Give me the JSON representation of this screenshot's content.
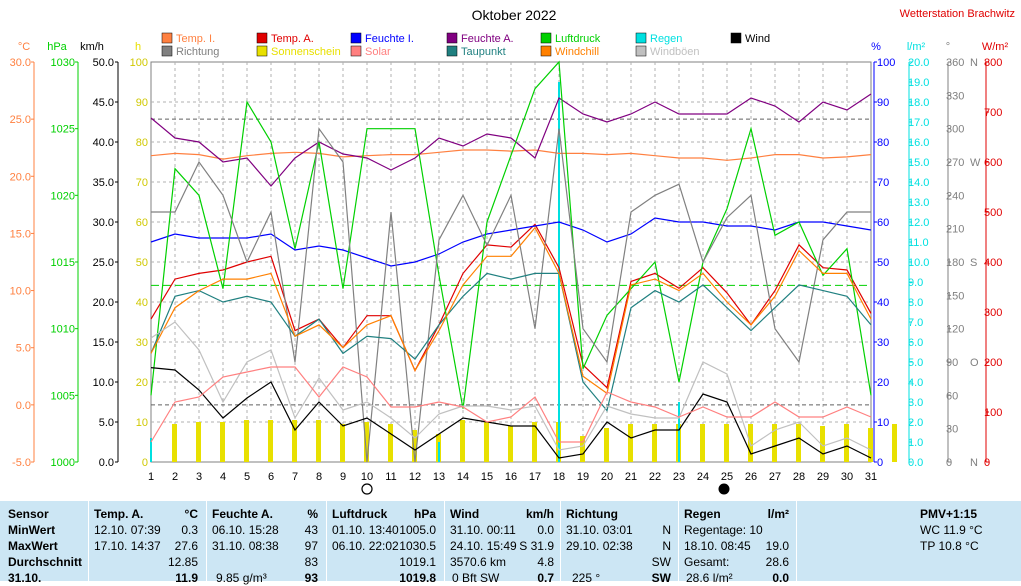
{
  "colors": {
    "temp_in": "#ff8040",
    "temp_out": "#e00000",
    "hum_in": "#0000ff",
    "hum_out": "#800080",
    "pressure": "#00d000",
    "rain": "#00e0e0",
    "wind": "#000000",
    "direction": "#808080",
    "sunshine": "#e8e000",
    "solar": "#ff8080",
    "dewpoint": "#208080",
    "windchill": "#ff8000",
    "gusts": "#c0c0c0",
    "station": "#e00000"
  },
  "chart_data": {
    "type": "line",
    "title": "Oktober 2022",
    "station": "Wetterstation Brachwitz",
    "x": [
      1,
      2,
      3,
      4,
      5,
      6,
      7,
      8,
      9,
      10,
      11,
      12,
      13,
      14,
      15,
      16,
      17,
      18,
      19,
      20,
      21,
      22,
      23,
      24,
      25,
      26,
      27,
      28,
      29,
      30,
      31
    ],
    "xlim": [
      1,
      31
    ],
    "moon_new_day": 25,
    "moon_full_day": 10,
    "legend": [
      {
        "label": "Temp. I.",
        "color": "#ff8040"
      },
      {
        "label": "Temp. A.",
        "color": "#e00000"
      },
      {
        "label": "Feuchte I.",
        "color": "#0000ff"
      },
      {
        "label": "Feuchte A.",
        "color": "#800080"
      },
      {
        "label": "Luftdruck",
        "color": "#00d000"
      },
      {
        "label": "Regen",
        "color": "#00e0e0"
      },
      {
        "label": "Wind",
        "color": "#000000"
      },
      {
        "label": "Richtung",
        "color": "#808080"
      },
      {
        "label": "Sonnenschein",
        "color": "#e8e000"
      },
      {
        "label": "Solar",
        "color": "#ff8080"
      },
      {
        "label": "Taupunkt",
        "color": "#208080"
      },
      {
        "label": "Windchill",
        "color": "#ff8000"
      },
      {
        "label": "Windböen",
        "color": "#c0c0c0"
      }
    ],
    "axes": [
      {
        "unit": "°C",
        "min": -5,
        "max": 30,
        "step": 5,
        "decimals": 1,
        "color": "#ff8040",
        "side": "left"
      },
      {
        "unit": "hPa",
        "min": 1000,
        "max": 1030,
        "step": 5,
        "decimals": 0,
        "color": "#00d000",
        "side": "left"
      },
      {
        "unit": "km/h",
        "min": 0,
        "max": 50,
        "step": 5,
        "decimals": 1,
        "color": "#000000",
        "side": "left"
      },
      {
        "unit": "h",
        "min": 0,
        "max": 100,
        "step": 10,
        "decimals": 0,
        "color": "#e8e000",
        "side": "left"
      },
      {
        "unit": "%",
        "min": 0,
        "max": 100,
        "step": 10,
        "decimals": 0,
        "color": "#0000ff",
        "side": "right"
      },
      {
        "unit": "l/m²",
        "min": 0,
        "max": 20,
        "step": 1,
        "decimals": 1,
        "color": "#00e0e0",
        "side": "right"
      },
      {
        "unit": "°",
        "min": 0,
        "max": 360,
        "step": 30,
        "decimals": 0,
        "color": "#808080",
        "side": "right"
      },
      {
        "unit": "W/m²",
        "min": 0,
        "max": 800,
        "step": 100,
        "decimals": 0,
        "color": "#e00000",
        "side": "right"
      }
    ],
    "compass": [
      {
        "label": "N",
        "value": 0
      },
      {
        "label": "O",
        "value": 90
      },
      {
        "label": "S",
        "value": 180
      },
      {
        "label": "W",
        "value": 270
      },
      {
        "label": "N",
        "value": 360
      }
    ],
    "series": [
      {
        "name": "Temp. I.",
        "axis": 0,
        "color": "#ff8040",
        "values": [
          21.8,
          22.0,
          21.9,
          21.5,
          21.8,
          22.0,
          22.1,
          22.0,
          21.7,
          21.8,
          21.9,
          21.9,
          22.1,
          22.3,
          22.3,
          22.2,
          22.3,
          22.0,
          22.0,
          21.9,
          22.0,
          21.8,
          21.6,
          21.6,
          21.4,
          21.6,
          21.9,
          21.9,
          21.6,
          21.7,
          21.9
        ]
      },
      {
        "name": "Temp. A.",
        "axis": 0,
        "color": "#e00000",
        "values": [
          7.5,
          11.0,
          11.5,
          11.8,
          12.5,
          13.0,
          6.5,
          7.5,
          5.0,
          7.8,
          7.8,
          3.0,
          7.0,
          11.5,
          14.0,
          13.8,
          15.8,
          12.0,
          3.5,
          1.5,
          10.8,
          11.5,
          10.2,
          12.0,
          9.8,
          7.0,
          10.0,
          14.0,
          12.0,
          11.8,
          8.0
        ]
      },
      {
        "name": "Feuchte I.",
        "axis": 4,
        "color": "#0000ff",
        "values": [
          55,
          57,
          56,
          56,
          56,
          57,
          53,
          54,
          53,
          51,
          49,
          50,
          52,
          55,
          57,
          58,
          59,
          60,
          58,
          55,
          57,
          61,
          60,
          60,
          59,
          59,
          58,
          60,
          60,
          59,
          58
        ]
      },
      {
        "name": "Feuchte A.",
        "axis": 4,
        "color": "#800080",
        "values": [
          86,
          81,
          80,
          75,
          76,
          69,
          76,
          80,
          77,
          76,
          73,
          76,
          81,
          79,
          82,
          81,
          76,
          91,
          87,
          85,
          87,
          90,
          87,
          87,
          87,
          91,
          89,
          85,
          90,
          88,
          92
        ]
      },
      {
        "name": "Luftdruck",
        "axis": 1,
        "color": "#00d000",
        "values": [
          1005,
          1022,
          1020,
          1013,
          1027,
          1024,
          1016,
          1024,
          1013,
          1025,
          1025,
          1025,
          1014,
          1004,
          1018,
          1023,
          1028,
          1030,
          1007,
          1011,
          1013,
          1015,
          1006,
          1015,
          1019,
          1025,
          1017,
          1018,
          1014,
          1016,
          1005
        ]
      },
      {
        "name": "Richtung",
        "axis": 6,
        "color": "#808080",
        "values": [
          225,
          225,
          270,
          240,
          180,
          225,
          90,
          300,
          270,
          0,
          225,
          0,
          200,
          240,
          195,
          240,
          120,
          300,
          120,
          90,
          225,
          240,
          250,
          180,
          220,
          240,
          120,
          90,
          200,
          225,
          225
        ]
      },
      {
        "name": "Taupunkt",
        "axis": 0,
        "color": "#208080",
        "values": [
          4.5,
          9.5,
          10.0,
          9.0,
          9.5,
          9.0,
          6.0,
          7.5,
          4.5,
          6.0,
          5.8,
          4.0,
          7.0,
          9.5,
          11.5,
          11.0,
          11.5,
          11.5,
          2.0,
          -0.5,
          8.5,
          10.0,
          9.0,
          10.5,
          8.5,
          6.5,
          8.5,
          10.5,
          10.0,
          9.5,
          7.0
        ]
      },
      {
        "name": "Windchill",
        "axis": 0,
        "color": "#ff8000",
        "values": [
          4.5,
          8.5,
          10.0,
          11.0,
          11.0,
          11.5,
          6.0,
          7.0,
          5.0,
          7.0,
          7.8,
          3.0,
          6.5,
          10.5,
          13.0,
          13.0,
          15.5,
          11.5,
          2.5,
          1.0,
          10.5,
          11.0,
          10.0,
          11.5,
          9.0,
          7.0,
          9.5,
          13.5,
          11.5,
          11.5,
          7.5
        ]
      },
      {
        "name": "Wind",
        "axis": 2,
        "color": "#000000",
        "values": [
          11.8,
          11.5,
          9.0,
          5.5,
          8.0,
          10.0,
          4.0,
          7.5,
          4.5,
          5.5,
          3.5,
          1.5,
          3.5,
          5.5,
          5.0,
          4.5,
          4.5,
          0.5,
          1.0,
          5.0,
          3.0,
          4.0,
          4.0,
          8.5,
          7.5,
          1.0,
          2.0,
          3.0,
          1.0,
          2.0,
          0.5
        ]
      },
      {
        "name": "Windböen",
        "axis": 2,
        "color": "#c0c0c0",
        "values": [
          15.5,
          17.5,
          14.0,
          7.5,
          12.5,
          14.0,
          5.5,
          10.5,
          6.5,
          7.5,
          5.5,
          3.0,
          6.0,
          7.0,
          7.0,
          6.5,
          7.0,
          1.5,
          2.0,
          7.0,
          6.0,
          5.5,
          5.5,
          12.5,
          11.0,
          2.0,
          4.0,
          5.0,
          2.0,
          3.0,
          1.5
        ]
      },
      {
        "name": "Solar",
        "axis": 7,
        "color": "#ff8080",
        "values": [
          40,
          120,
          130,
          170,
          180,
          190,
          190,
          130,
          190,
          170,
          110,
          110,
          120,
          110,
          80,
          90,
          130,
          40,
          40,
          140,
          120,
          110,
          90,
          110,
          90,
          90,
          120,
          90,
          90,
          110,
          90
        ]
      }
    ],
    "sunshine": [
      9.5,
      10.0,
      10.0,
      10.5,
      10.5,
      10.5,
      10.5,
      9.5,
      10.0,
      9.5,
      8.0,
      7.0,
      10.5,
      10.0,
      9.0,
      10.0,
      10.0,
      6.5,
      8.5,
      9.5,
      9.5,
      9.5,
      9.5,
      9.5,
      9.5,
      9.5,
      9.5,
      9.0,
      9.5,
      8.5,
      9.5
    ],
    "rain": [
      1.2,
      0,
      0,
      0,
      0,
      0,
      0,
      0,
      0,
      0,
      0,
      0,
      1.0,
      0,
      0,
      0,
      0,
      19.0,
      0,
      0,
      0,
      0,
      3.0,
      0,
      0,
      0,
      0,
      0,
      0,
      0,
      0
    ],
    "reference_line": {
      "axis": 1,
      "value": 1013.25,
      "color": "#00d000"
    }
  },
  "stats": {
    "row_labels": [
      "Sensor",
      "MinWert",
      "MaxWert",
      "Durchschnitt",
      "31.10."
    ],
    "temp": {
      "title": "Temp. A.",
      "unit": "°C",
      "rows": [
        [
          "12.10.  07:39",
          "0.3"
        ],
        [
          "17.10.  14:37",
          "27.6"
        ],
        [
          "",
          "12.85"
        ],
        [
          "",
          "11.9"
        ]
      ]
    },
    "hum": {
      "title": "Feuchte A.",
      "unit": "%",
      "rows": [
        [
          "06.10.  15:28",
          "43"
        ],
        [
          "31.10.  08:38",
          "97"
        ],
        [
          "",
          "83"
        ],
        [
          "9.85 g/m³",
          "93"
        ]
      ]
    },
    "press": {
      "title": "Luftdruck",
      "unit": "hPa",
      "rows": [
        [
          "01.10.  13:40",
          "1005.0"
        ],
        [
          "06.10.  22:02",
          "1030.5"
        ],
        [
          "",
          "1019.1"
        ],
        [
          "",
          "1019.8"
        ]
      ]
    },
    "wind": {
      "title": "Wind",
      "unit": "km/h",
      "rows": [
        [
          "31.10.  00:11",
          "0.0"
        ],
        [
          "24.10.  15:49",
          "S 31.9"
        ],
        [
          "3570.6 km",
          "4.8"
        ],
        [
          "0 Bft SW",
          "0.7"
        ]
      ]
    },
    "dir": {
      "title": "Richtung",
      "unit": "",
      "rows": [
        [
          "31.10.  03:01",
          "N"
        ],
        [
          "29.10.  02:38",
          "N"
        ],
        [
          "",
          "SW"
        ],
        [
          "225 °",
          "SW"
        ]
      ]
    },
    "rain": {
      "title": "Regen",
      "unit": "l/m²",
      "rows": [
        [
          "Regentage: 10",
          ""
        ],
        [
          "18.10.  08:45",
          "19.0"
        ],
        [
          "Gesamt:",
          "28.6"
        ],
        [
          "28.6 l/m²",
          "0.0"
        ]
      ]
    },
    "pmv": {
      "title": "PMV+1:15",
      "lines": [
        "WC 11.9 °C",
        "TP 10.8 °C"
      ]
    }
  }
}
